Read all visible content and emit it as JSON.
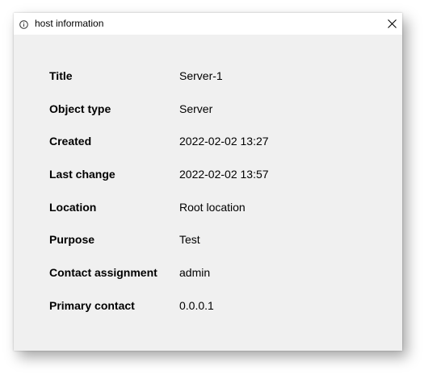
{
  "window": {
    "title": "host information",
    "icons": {
      "title_icon": "info-icon",
      "close": "close-icon"
    }
  },
  "properties": [
    {
      "label": "Title",
      "value": "Server-1"
    },
    {
      "label": "Object type",
      "value": "Server"
    },
    {
      "label": "Created",
      "value": "2022-02-02 13:27"
    },
    {
      "label": "Last change",
      "value": "2022-02-02 13:57"
    },
    {
      "label": "Location",
      "value": "Root location"
    },
    {
      "label": "Purpose",
      "value": "Test"
    },
    {
      "label": "Contact assignment",
      "value": "admin"
    },
    {
      "label": "Primary contact",
      "value": "0.0.0.1"
    }
  ]
}
